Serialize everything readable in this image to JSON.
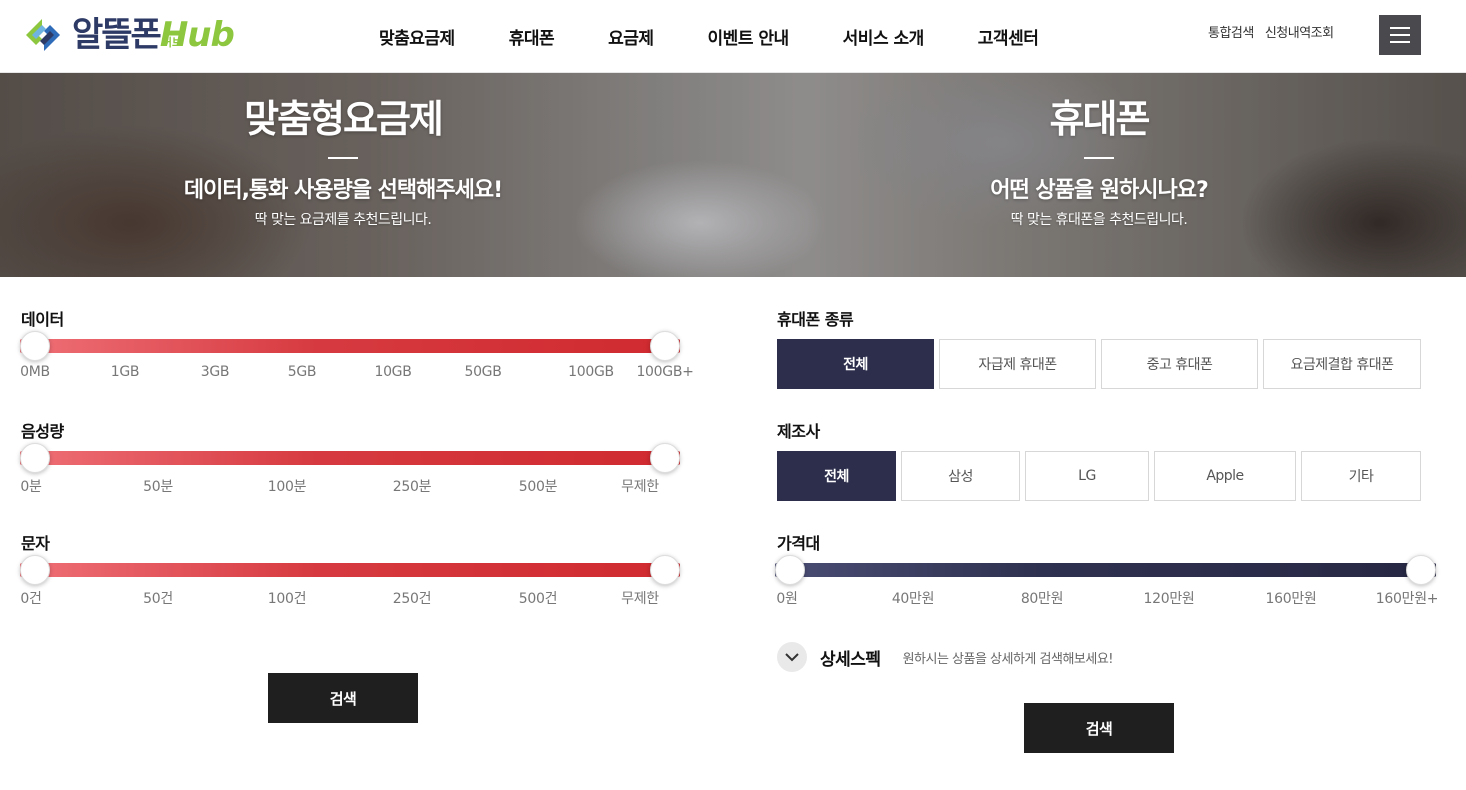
{
  "brand": {
    "name": "알뜰폰",
    "hub": "Hub",
    "hub_sub": "허브"
  },
  "nav": [
    "맞춤요금제",
    "휴대폰",
    "요금제",
    "이벤트 안내",
    "서비스 소개",
    "고객센터"
  ],
  "util": [
    "통합검색",
    "신청내역조회"
  ],
  "banner": {
    "left": {
      "title": "맞춤형요금제",
      "subtitle": "데이터,통화 사용량을 선택해주세요!",
      "desc": "딱 맞는 요금제를 추천드립니다."
    },
    "right": {
      "title": "휴대폰",
      "subtitle": "어떤 상품을 원하시나요?",
      "desc": "딱 맞는 휴대폰을 추천드립니다."
    }
  },
  "plan": {
    "data": {
      "label": "데이터",
      "ticks": [
        "0MB",
        "1GB",
        "3GB",
        "5GB",
        "10GB",
        "50GB",
        "100GB",
        "100GB+"
      ],
      "min": 0,
      "max": 1
    },
    "voice": {
      "label": "음성량",
      "ticks": [
        "0분",
        "50분",
        "100분",
        "250분",
        "500분",
        "무제한"
      ],
      "min": 0,
      "max": 1
    },
    "sms": {
      "label": "문자",
      "ticks": [
        "0건",
        "50건",
        "100건",
        "250건",
        "500건",
        "무제한"
      ],
      "min": 0,
      "max": 1
    },
    "search_label": "검색"
  },
  "phone": {
    "type": {
      "label": "휴대폰 종류",
      "options": [
        "전체",
        "자급제 휴대폰",
        "중고 휴대폰",
        "요금제결합 휴대폰"
      ],
      "selected": "전체"
    },
    "maker": {
      "label": "제조사",
      "options": [
        "전체",
        "삼성",
        "LG",
        "Apple",
        "기타"
      ],
      "selected": "전체"
    },
    "price": {
      "label": "가격대",
      "ticks": [
        "0원",
        "40만원",
        "80만원",
        "120만원",
        "160만원",
        "160만원+"
      ],
      "min": 0,
      "max": 1
    },
    "detail": {
      "title": "상세스펙",
      "desc": "원하시는 상품을 상세하게 검색해보세요!"
    },
    "search_label": "검색"
  },
  "colors": {
    "brand_navy": "#2e3a66",
    "brand_green": "#8dc63f",
    "slider_red": "#d63a40",
    "slider_navy": "#2c2e4c",
    "active_chip": "#2c2e4c"
  }
}
